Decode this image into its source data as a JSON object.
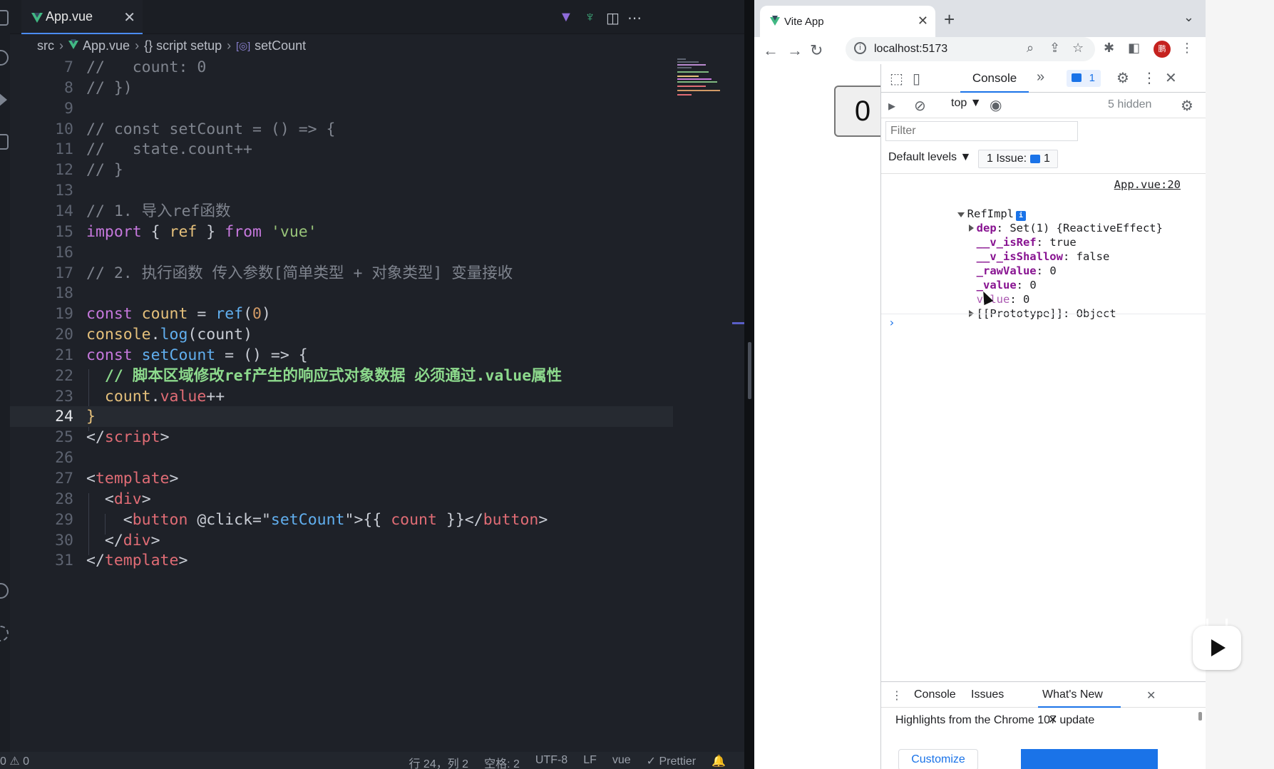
{
  "editor": {
    "tab": {
      "label": "App.vue",
      "close": "✕"
    },
    "breadcrumb": {
      "folder": "src",
      "file": "App.vue",
      "section": "{} script setup",
      "symbol": "setCount"
    },
    "lines": [
      {
        "n": "7",
        "tokens": [
          {
            "t": "//   count: 0",
            "c": "c-com"
          }
        ]
      },
      {
        "n": "8",
        "tokens": [
          {
            "t": "// })",
            "c": "c-com"
          }
        ]
      },
      {
        "n": "9",
        "tokens": []
      },
      {
        "n": "10",
        "tokens": [
          {
            "t": "// const setCount = () => {",
            "c": "c-com"
          }
        ]
      },
      {
        "n": "11",
        "tokens": [
          {
            "t": "//   state.count++",
            "c": "c-com"
          }
        ]
      },
      {
        "n": "12",
        "tokens": [
          {
            "t": "// }",
            "c": "c-com"
          }
        ]
      },
      {
        "n": "13",
        "tokens": []
      },
      {
        "n": "14",
        "tokens": [
          {
            "t": "// 1. 导入ref函数",
            "c": "c-com"
          }
        ]
      },
      {
        "n": "15",
        "tokens": [
          {
            "t": "import",
            "c": "c-kw"
          },
          {
            "t": " { ",
            "c": "c-plain"
          },
          {
            "t": "ref",
            "c": "c-var"
          },
          {
            "t": " } ",
            "c": "c-plain"
          },
          {
            "t": "from",
            "c": "c-kw"
          },
          {
            "t": " ",
            "c": "c-plain"
          },
          {
            "t": "'vue'",
            "c": "c-str"
          }
        ]
      },
      {
        "n": "16",
        "tokens": []
      },
      {
        "n": "17",
        "tokens": [
          {
            "t": "// 2. 执行函数 传入参数[简单类型 + 对象类型] 变量接收",
            "c": "c-com"
          }
        ]
      },
      {
        "n": "18",
        "tokens": []
      },
      {
        "n": "19",
        "tokens": [
          {
            "t": "const",
            "c": "c-kw"
          },
          {
            "t": " count",
            "c": "c-var"
          },
          {
            "t": " = ",
            "c": "c-plain"
          },
          {
            "t": "ref",
            "c": "c-fn"
          },
          {
            "t": "(",
            "c": "c-plain"
          },
          {
            "t": "0",
            "c": "c-num"
          },
          {
            "t": ")",
            "c": "c-plain"
          }
        ]
      },
      {
        "n": "20",
        "tokens": [
          {
            "t": "console",
            "c": "c-var"
          },
          {
            "t": ".",
            "c": "c-plain"
          },
          {
            "t": "log",
            "c": "c-fn"
          },
          {
            "t": "(count)",
            "c": "c-plain"
          }
        ]
      },
      {
        "n": "21",
        "tokens": [
          {
            "t": "const",
            "c": "c-kw"
          },
          {
            "t": " setCount",
            "c": "c-fn"
          },
          {
            "t": " = () => {",
            "c": "c-plain"
          }
        ]
      },
      {
        "n": "22",
        "tokens": [
          {
            "t": "  // 脚本区域修改ref产生的响应式对象数据 必须通过.value属性",
            "c": "c-com-b"
          }
        ]
      },
      {
        "n": "23",
        "tokens": [
          {
            "t": "  count",
            "c": "c-var"
          },
          {
            "t": ".",
            "c": "c-plain"
          },
          {
            "t": "value",
            "c": "c-prop"
          },
          {
            "t": "++",
            "c": "c-plain"
          }
        ]
      },
      {
        "n": "24",
        "tokens": [
          {
            "t": "}",
            "c": "c-var"
          }
        ],
        "current": true
      },
      {
        "n": "25",
        "tokens": [
          {
            "t": "</",
            "c": "c-plain"
          },
          {
            "t": "script",
            "c": "c-tag"
          },
          {
            "t": ">",
            "c": "c-plain"
          }
        ]
      },
      {
        "n": "26",
        "tokens": []
      },
      {
        "n": "27",
        "tokens": [
          {
            "t": "<",
            "c": "c-plain"
          },
          {
            "t": "template",
            "c": "c-tag"
          },
          {
            "t": ">",
            "c": "c-plain"
          }
        ]
      },
      {
        "n": "28",
        "tokens": [
          {
            "t": "  <",
            "c": "c-plain"
          },
          {
            "t": "div",
            "c": "c-tag"
          },
          {
            "t": ">",
            "c": "c-plain"
          }
        ]
      },
      {
        "n": "29",
        "tokens": [
          {
            "t": "    <",
            "c": "c-plain"
          },
          {
            "t": "button",
            "c": "c-tag"
          },
          {
            "t": " @click=",
            "c": "c-plain"
          },
          {
            "t": "\"",
            "c": "c-plain"
          },
          {
            "t": "setCount",
            "c": "c-fn"
          },
          {
            "t": "\"",
            "c": "c-plain"
          },
          {
            "t": ">{{ ",
            "c": "c-plain"
          },
          {
            "t": "count",
            "c": "c-tag"
          },
          {
            "t": " }}</",
            "c": "c-plain"
          },
          {
            "t": "button",
            "c": "c-tag"
          },
          {
            "t": ">",
            "c": "c-plain"
          }
        ]
      },
      {
        "n": "30",
        "tokens": [
          {
            "t": "  </",
            "c": "c-plain"
          },
          {
            "t": "div",
            "c": "c-tag"
          },
          {
            "t": ">",
            "c": "c-plain"
          }
        ]
      },
      {
        "n": "31",
        "tokens": [
          {
            "t": "</",
            "c": "c-plain"
          },
          {
            "t": "template",
            "c": "c-tag"
          },
          {
            "t": ">",
            "c": "c-plain"
          }
        ]
      }
    ],
    "status": {
      "left": "0 ⚠ 0",
      "position": "行 24，列 2",
      "spaces": "空格: 2",
      "encoding": "UTF-8",
      "eol": "LF",
      "language": "vue",
      "formatter": "✓ Prettier"
    }
  },
  "browser": {
    "tab_title": "Vite App",
    "tab_close": "✕",
    "url": "localhost:5173",
    "profile_initial": "鹏",
    "page_button_label": "0",
    "devtools": {
      "console_tab": "Console",
      "issue_badge_count": "1",
      "context": "top ▼",
      "hidden": "5 hidden",
      "filter_placeholder": "Filter",
      "levels": "Default levels ▼",
      "issues_label": "1 Issue:",
      "issues_count": "1",
      "source_link": "App.vue:20",
      "object_name": "RefImpl",
      "dep_key": "dep",
      "dep_val": "Set(1) {ReactiveEffect}",
      "isref_key": "__v_isRef",
      "isref_val": "true",
      "isshallow_key": "__v_isShallow",
      "isshallow_val": "false",
      "rawvalue_key": "_rawValue",
      "rawvalue_val": "0",
      "value_key_priv": "_value",
      "value_val_priv": "0",
      "value_key": "value",
      "value_val": "0",
      "proto_key": "[[Prototype]]",
      "proto_val": "Object",
      "prompt": "›",
      "drawer": {
        "tabs": [
          "Console",
          "Issues",
          "What's New"
        ],
        "whats_new_text": "Highlights from the Chrome 107 update",
        "customize": "Customize"
      }
    }
  },
  "colors": {
    "accent": "#1a73e8",
    "vue_green": "#41b883",
    "editor_bg": "#1e2128"
  }
}
